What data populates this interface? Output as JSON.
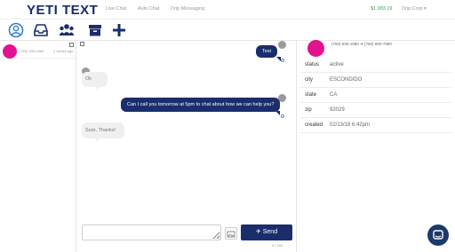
{
  "app": {
    "logo_text": "YETI TEXT"
  },
  "nav": {
    "links": [
      "Live Chat",
      "Auto Chat",
      "Drip Messaging"
    ],
    "balance": "$1,983.19",
    "account": "Drip Corp ▾"
  },
  "toolbar": {
    "icons": [
      "contacts-icon",
      "inbox-icon",
      "groups-icon",
      "archive-icon",
      "add-icon"
    ]
  },
  "conversations": [
    {
      "phone": "(760) 535-1980",
      "time": "2 weeks ago"
    }
  ],
  "messages": [
    {
      "direction": "outgoing",
      "text": "Test"
    },
    {
      "direction": "incoming",
      "text": "Ok"
    },
    {
      "direction": "outgoing",
      "text": "Can I call you tomorrow at 5pm to chat about how we can help you?"
    },
    {
      "direction": "incoming",
      "text": "Sure, Thanks!"
    }
  ],
  "composer": {
    "placeholder": "",
    "send_label": "Send",
    "counter": "0 / 160"
  },
  "contact": {
    "phones": "(760) 535-1980 ➔ (760) 990-7880",
    "details": [
      {
        "label": "status",
        "value": "active"
      },
      {
        "label": "city",
        "value": "ESCONDIDO"
      },
      {
        "label": "state",
        "value": "CA"
      },
      {
        "label": "zip",
        "value": "92029"
      },
      {
        "label": "created",
        "value": "02/13/18 6:42pm"
      }
    ]
  },
  "colors": {
    "brand_navy": "#1b2d6b",
    "accent_blue": "#2f7fd1",
    "avatar_pink": "#e3128f",
    "balance_green": "#3aa356"
  }
}
